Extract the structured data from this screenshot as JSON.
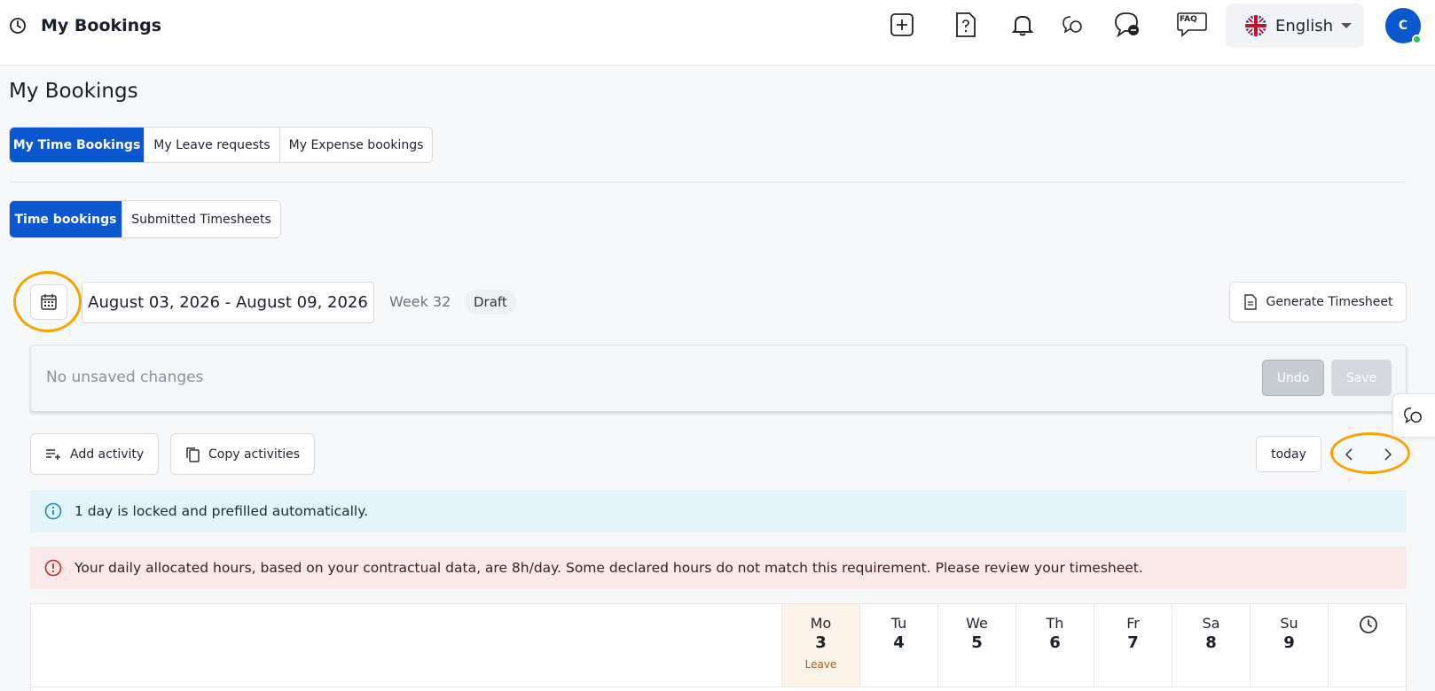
{
  "header": {
    "title": "My Bookings",
    "faq_label": "FAQ",
    "language": "English",
    "avatar_initial": "C"
  },
  "page": {
    "title": "My Bookings"
  },
  "main_tabs": [
    {
      "label": "My Time Bookings",
      "active": true
    },
    {
      "label": "My Leave requests",
      "active": false
    },
    {
      "label": "My Expense bookings",
      "active": false
    }
  ],
  "sub_tabs": [
    {
      "label": "Time bookings",
      "active": true
    },
    {
      "label": "Submitted Timesheets",
      "active": false
    }
  ],
  "period": {
    "date_range": "August 03, 2026 - August 09, 2026",
    "week": "Week 32",
    "status": "Draft",
    "generate_label": "Generate Timesheet"
  },
  "changes": {
    "message": "No unsaved changes",
    "undo_label": "Undo",
    "save_label": "Save"
  },
  "actions": {
    "add_activity": "Add activity",
    "copy_activities": "Copy activities",
    "today": "today"
  },
  "alerts": {
    "info": "1 day is locked and prefilled automatically.",
    "warning": "Your daily allocated hours, based on your contractual data, are 8h/day. Some declared hours do not match this requirement. Please review your timesheet."
  },
  "days": [
    {
      "name": "Mo",
      "num": "3",
      "note": "Leave",
      "leave": true
    },
    {
      "name": "Tu",
      "num": "4",
      "note": "",
      "leave": false
    },
    {
      "name": "We",
      "num": "5",
      "note": "",
      "leave": false
    },
    {
      "name": "Th",
      "num": "6",
      "note": "",
      "leave": false
    },
    {
      "name": "Fr",
      "num": "7",
      "note": "",
      "leave": false
    },
    {
      "name": "Sa",
      "num": "8",
      "note": "",
      "leave": false
    },
    {
      "name": "Su",
      "num": "9",
      "note": "",
      "leave": false
    }
  ],
  "colors": {
    "primary": "#0b57d0",
    "highlight": "#f5a400",
    "info_bg": "#e4f4fb",
    "warn_bg": "#fbe9ea",
    "leave_bg": "#fdf3e8"
  }
}
